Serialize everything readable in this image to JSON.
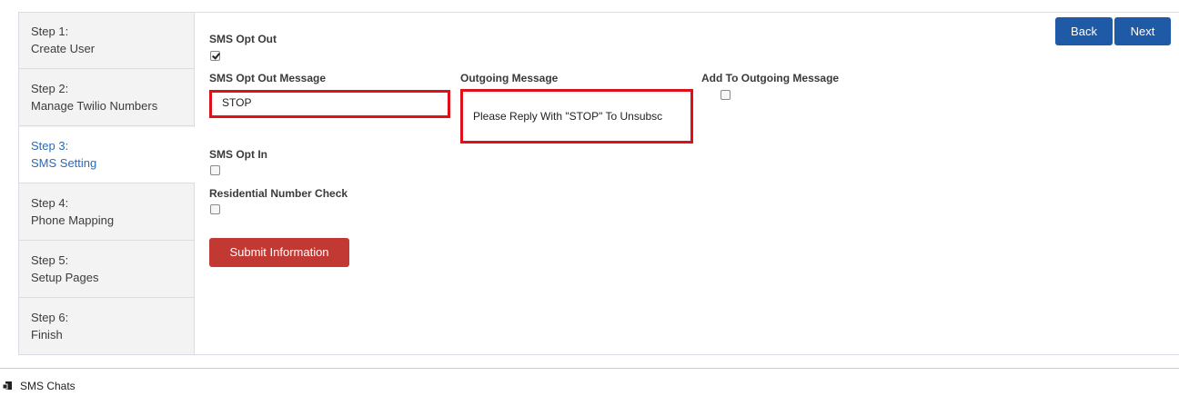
{
  "steps": [
    {
      "number": "Step 1:",
      "label": "Create User",
      "active": false
    },
    {
      "number": "Step 2:",
      "label": "Manage Twilio Numbers",
      "active": false
    },
    {
      "number": "Step 3:",
      "label": "SMS Setting",
      "active": true
    },
    {
      "number": "Step 4:",
      "label": "Phone Mapping",
      "active": false
    },
    {
      "number": "Step 5:",
      "label": "Setup Pages",
      "active": false
    },
    {
      "number": "Step 6:",
      "label": "Finish",
      "active": false
    }
  ],
  "nav": {
    "back_label": "Back",
    "next_label": "Next"
  },
  "form": {
    "sms_opt_out": {
      "label": "SMS Opt Out",
      "checked": true
    },
    "opt_out_message": {
      "label": "SMS Opt Out Message",
      "value": "STOP"
    },
    "outgoing_message": {
      "label": "Outgoing Message",
      "value": "Please Reply With \"STOP\" To Unsubsc"
    },
    "add_to_outgoing": {
      "label": "Add To Outgoing Message",
      "checked": false
    },
    "sms_opt_in": {
      "label": "SMS Opt In",
      "checked": false
    },
    "residential_check": {
      "label": "Residential Number Check",
      "checked": false
    },
    "submit_label": "Submit Information"
  },
  "footer": {
    "label": "SMS Chats",
    "icon": "chat-icon"
  },
  "colors": {
    "primary": "#1f5aa6",
    "submit": "#c23934",
    "highlight": "#e0101a",
    "active_step": "#2a6ab8"
  }
}
